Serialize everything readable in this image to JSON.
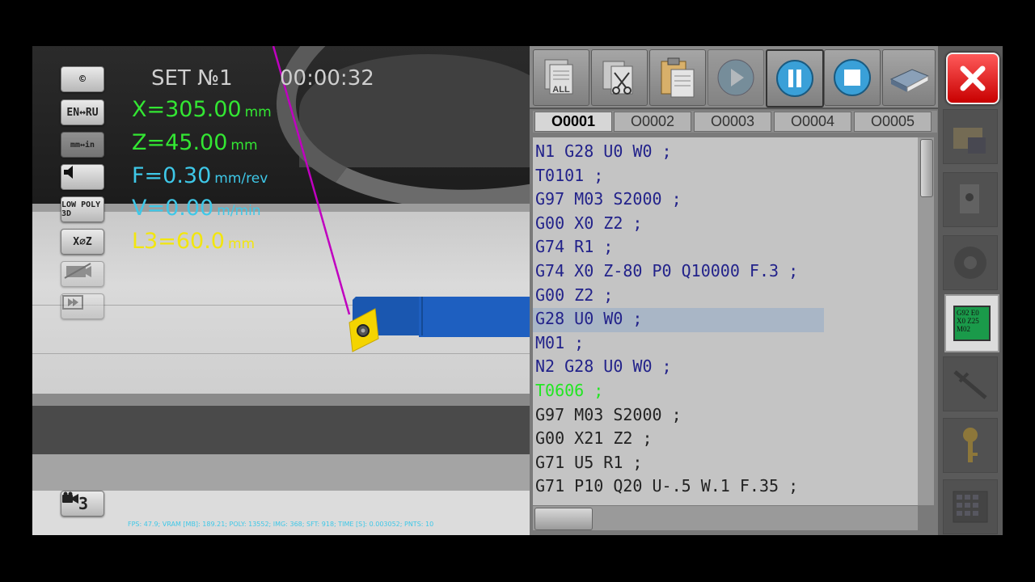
{
  "hud": {
    "set_title": "SET №1",
    "timer": "00:00:32",
    "x_value": "X=305.00",
    "x_unit": "mm",
    "z_value": "Z=45.00",
    "z_unit": "mm",
    "f_value": "F=0.30",
    "f_unit": "mm/rev",
    "v_value": "V=0.00",
    "v_unit": "m/min",
    "l3_value": "L3=60.0",
    "l3_unit": "mm",
    "fps_line": "FPS: 47.9; VRAM [MB]: 189.21; POLY: 13552; IMG: 368; SFT: 918; TIME [S]: 0.003052; PNTS: 10"
  },
  "colors": {
    "x": "#33e633",
    "z": "#33e633",
    "f": "#3ec8e8",
    "v": "#3ec8e8",
    "l3": "#f2e60e",
    "tool_holder": "#1a57b0",
    "insert": "#f4d400",
    "path_line": "#c000c0"
  },
  "left_toolbar": [
    {
      "name": "copyright-button",
      "label": "©"
    },
    {
      "name": "language-button",
      "label": "EN↔RU"
    },
    {
      "name": "units-button",
      "label": "mm↔in"
    },
    {
      "name": "sound-button",
      "icon": "speaker-icon"
    },
    {
      "name": "low-poly-3d-button",
      "label": "LOW POLY 3D"
    },
    {
      "name": "axis-button",
      "label": "X∅Z"
    },
    {
      "name": "screenshot-button",
      "icon": "camera-disabled-icon"
    },
    {
      "name": "step-button",
      "icon": "step-forward-icon"
    }
  ],
  "camera_label": "3",
  "program": {
    "toolbar_icons": [
      "copy-all-icon",
      "cut-paste-icon",
      "clipboard-icon",
      "play-icon",
      "pause-icon",
      "stop-icon",
      "book-icon"
    ],
    "copy_all_label": "ALL",
    "tabs": [
      "O0001",
      "O0002",
      "O0003",
      "O0004",
      "O0005"
    ],
    "active_tab": "O0001",
    "lines": [
      "N1 G28 U0 W0 ;",
      "T0101 ;",
      "G97 M03 S2000 ;",
      "G00 X0 Z2 ;",
      "G74 R1 ;",
      "G74 X0 Z-80 P0 Q10000 F.3 ;",
      "G00 Z2 ;",
      "G28 U0 W0 ;",
      "M01 ;",
      "N2 G28 U0 W0 ;",
      "T0606 ;",
      "G97 M03 S2000 ;",
      "G00 X21 Z2 ;",
      "G71 U5 R1 ;",
      "G71 P10 Q20 U-.5 W.1 F.35 ;"
    ],
    "highlighted_line_index": 7,
    "running_line_index": 10
  },
  "right_toolbar": {
    "close_icon": "close-icon",
    "g92_lines": [
      "G92 E0",
      "X0 Z25",
      "M02"
    ]
  }
}
